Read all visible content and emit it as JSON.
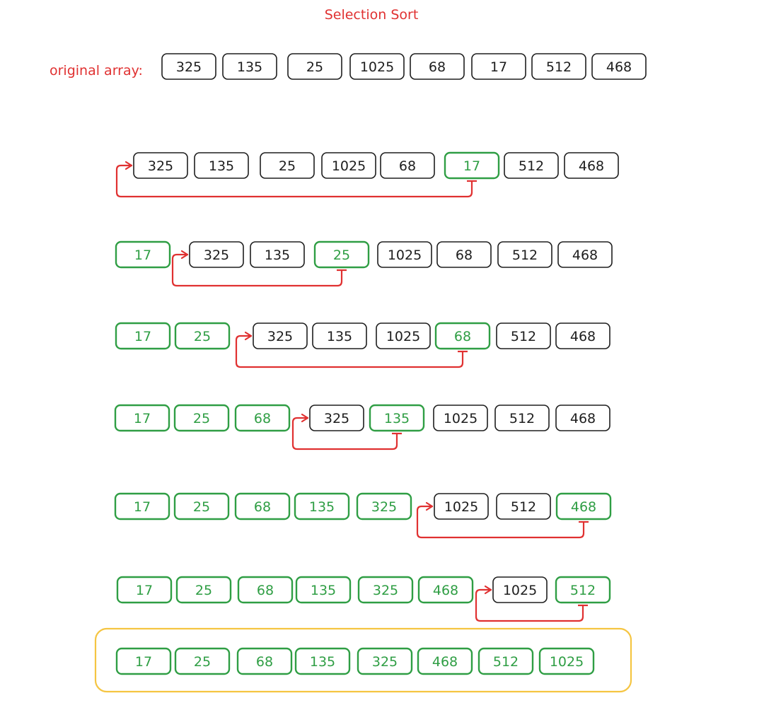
{
  "title": "Selection Sort",
  "original_label": "original array:",
  "colors": {
    "title": "#e03131",
    "default_stroke": "#1e1e1e",
    "default_text": "#1e1e1e",
    "sorted": "#2f9e44",
    "arrow": "#e03131",
    "result_frame": "#f5c542"
  },
  "original_array": [
    325,
    135,
    25,
    1025,
    68,
    17,
    512,
    468
  ],
  "steps": [
    {
      "values": [
        325,
        135,
        25,
        1025,
        68,
        17,
        512,
        468
      ],
      "green": [
        5
      ],
      "swap": [
        0,
        5
      ]
    },
    {
      "values": [
        17,
        325,
        135,
        25,
        1025,
        68,
        512,
        468
      ],
      "green": [
        0,
        3
      ],
      "swap": [
        1,
        3
      ]
    },
    {
      "values": [
        17,
        25,
        325,
        135,
        1025,
        68,
        512,
        468
      ],
      "green": [
        0,
        1,
        5
      ],
      "swap": [
        2,
        5
      ]
    },
    {
      "values": [
        17,
        25,
        68,
        325,
        135,
        1025,
        512,
        468
      ],
      "green": [
        0,
        1,
        2,
        4
      ],
      "swap": [
        3,
        4
      ]
    },
    {
      "values": [
        17,
        25,
        68,
        135,
        325,
        1025,
        512,
        468
      ],
      "green": [
        0,
        1,
        2,
        3,
        4,
        7
      ],
      "swap": [
        5,
        7
      ]
    },
    {
      "values": [
        17,
        25,
        68,
        135,
        325,
        468,
        1025,
        512
      ],
      "green": [
        0,
        1,
        2,
        3,
        4,
        5,
        7
      ],
      "swap": [
        6,
        7
      ]
    }
  ],
  "sorted_array": [
    17,
    25,
    68,
    135,
    325,
    468,
    512,
    1025
  ]
}
